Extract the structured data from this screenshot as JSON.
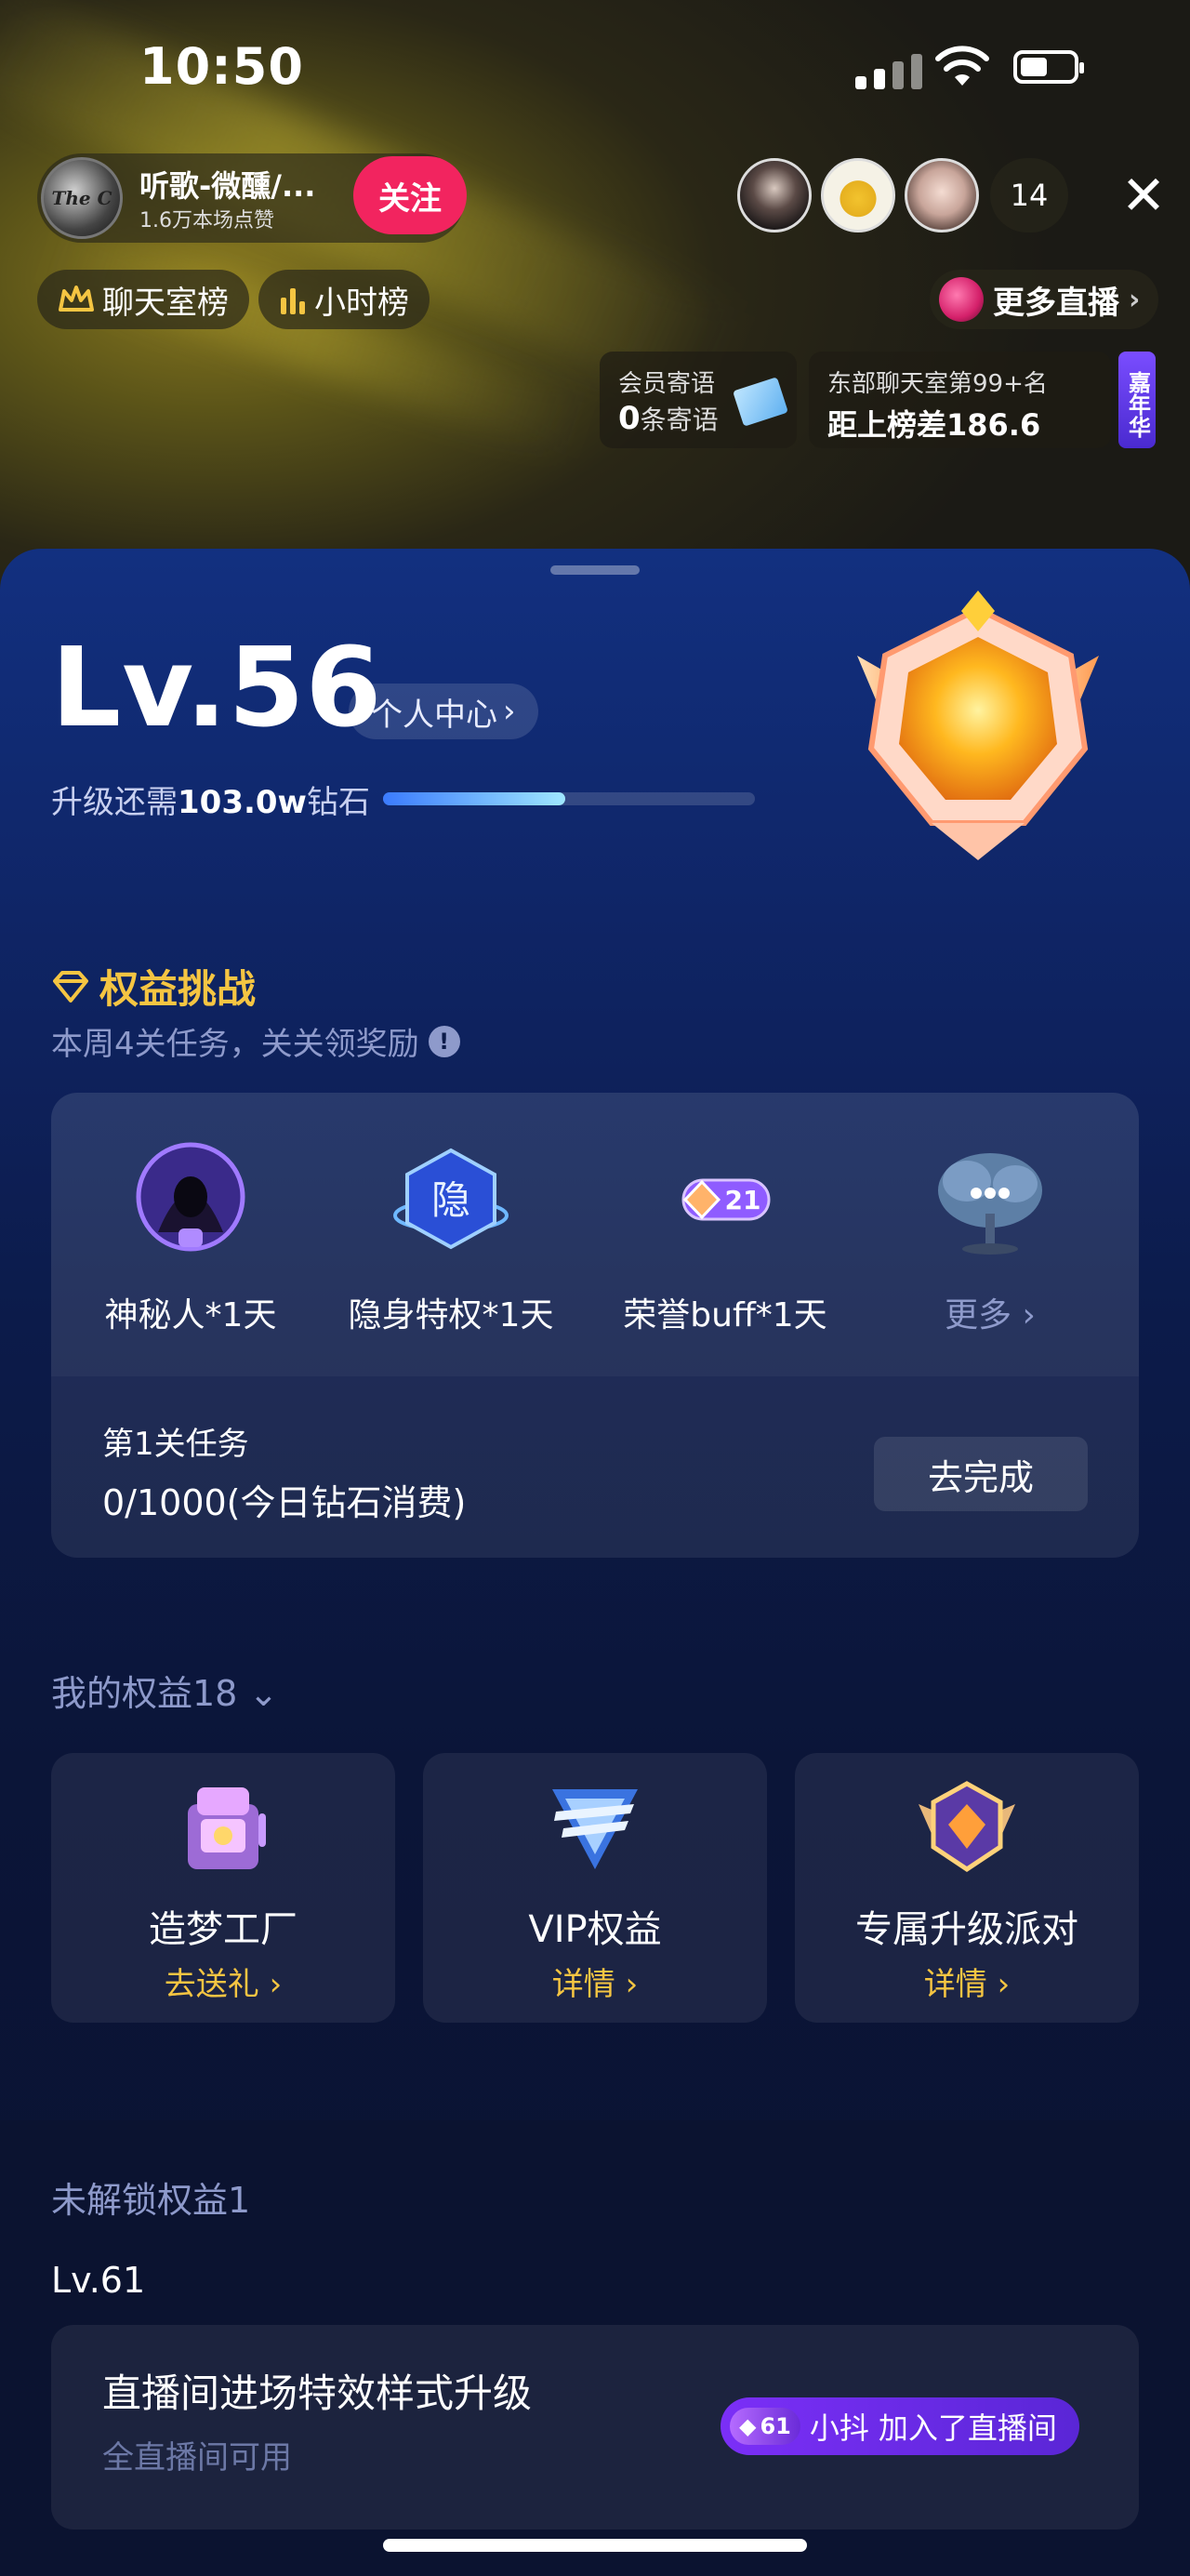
{
  "status_bar": {
    "time": "10:50"
  },
  "host": {
    "name": "听歌-微醺/...",
    "likes": "1.6万本场点赞",
    "avatar_text": "The C",
    "follow_label": "关注"
  },
  "viewers": {
    "count": "14"
  },
  "chips": {
    "chat_rank": "聊天室榜",
    "hour_rank": "小时榜",
    "more_live": "更多直播"
  },
  "member_msg": {
    "title": "会员寄语",
    "count": "0",
    "unit": "条寄语"
  },
  "room_rank": {
    "title": "东部聊天室第99+名",
    "gap": "距上榜差186.6"
  },
  "carnival": "嘉年华",
  "level": {
    "label": "Lv.56",
    "center_label": "个人中心",
    "need_prefix": "升级还需",
    "need_value": "103.0w",
    "need_suffix": "钻石",
    "progress": 0.49
  },
  "challenge": {
    "title": "权益挑战",
    "subtitle": "本周4关任务，关关领奖励",
    "rewards": [
      {
        "label": "神秘人*1天",
        "icon": "mystery-person-icon"
      },
      {
        "label": "隐身特权*1天",
        "icon": "invisible-icon",
        "glyph": "隐"
      },
      {
        "label": "荣誉buff*1天",
        "icon": "honor-buff-icon",
        "badge": "21"
      },
      {
        "label": "更多",
        "icon": "more-tree-icon"
      }
    ],
    "task_title": "第1关任务",
    "task_value": "0/1000(今日钻石消费)",
    "go_label": "去完成"
  },
  "my_rights": {
    "title": "我的权益18",
    "items": [
      {
        "name": "造梦工厂",
        "action": "去送礼",
        "icon": "dream-factory-icon"
      },
      {
        "name": "VIP权益",
        "action": "详情",
        "icon": "vip-icon"
      },
      {
        "name": "专属升级派对",
        "action": "详情",
        "icon": "party-badge-icon"
      }
    ]
  },
  "locked": {
    "title": "未解锁权益1",
    "level": "Lv.61",
    "item_title": "直播间进场特效样式升级",
    "item_sub": "全直播间可用",
    "toast_level": "61",
    "toast_user": "小抖",
    "toast_text": "加入了直播间"
  },
  "colors": {
    "accent_gold": "#f5c542",
    "follow_pink": "#f2245f",
    "panel_blue": "#123080"
  }
}
